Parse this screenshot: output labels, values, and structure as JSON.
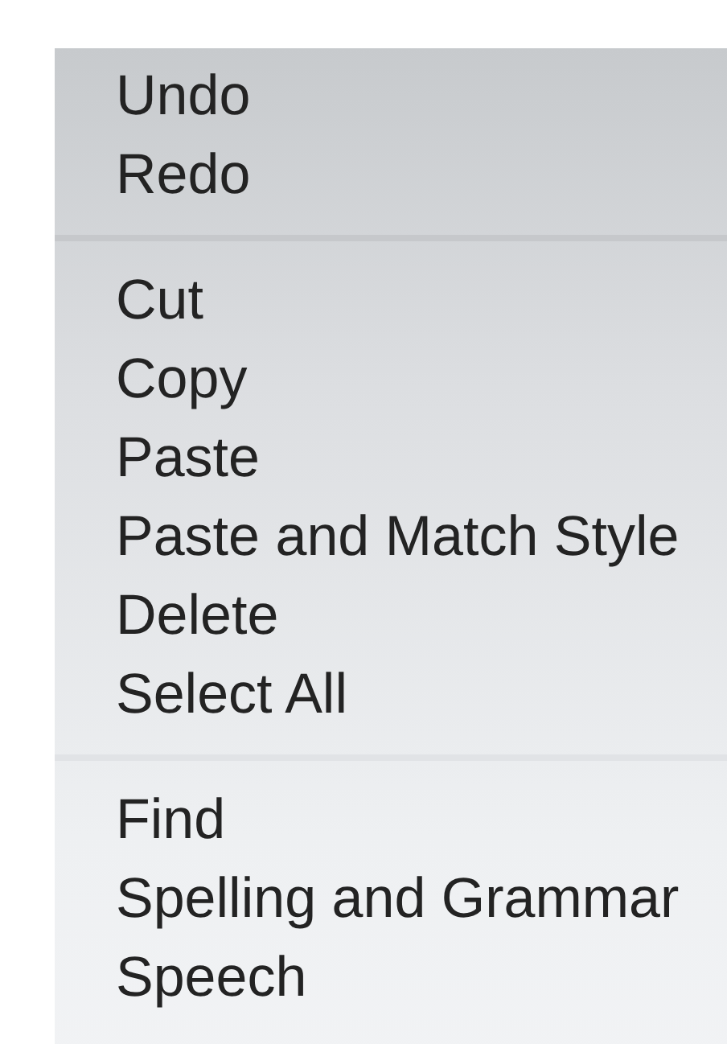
{
  "menu": {
    "groups": [
      {
        "items": [
          {
            "label": "Undo"
          },
          {
            "label": "Redo"
          }
        ]
      },
      {
        "items": [
          {
            "label": "Cut"
          },
          {
            "label": "Copy"
          },
          {
            "label": "Paste"
          },
          {
            "label": "Paste and Match Style"
          },
          {
            "label": "Delete"
          },
          {
            "label": "Select All"
          }
        ]
      },
      {
        "items": [
          {
            "label": "Find"
          },
          {
            "label": "Spelling and Grammar"
          },
          {
            "label": "Speech"
          }
        ]
      }
    ]
  }
}
